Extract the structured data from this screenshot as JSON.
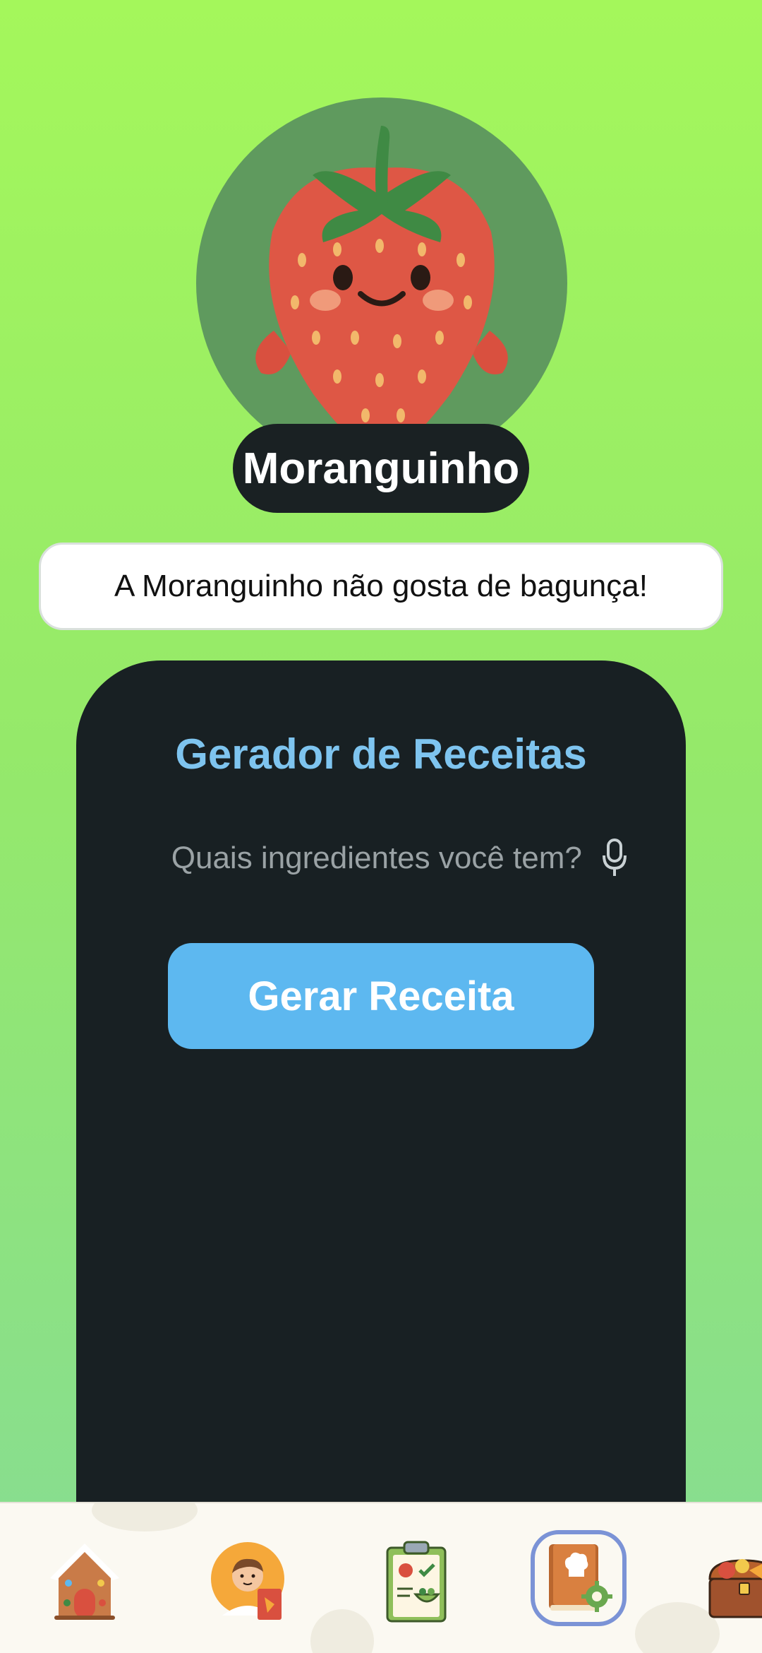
{
  "character": {
    "name": "Moranguinho",
    "message": "A Moranguinho não gosta de bagunça!"
  },
  "recipe_generator": {
    "title": "Gerador de Receitas",
    "ingredients_placeholder": "Quais ingredientes você tem?",
    "generate_button_label": "Gerar Receita"
  },
  "bottom_nav": {
    "items": [
      {
        "icon": "gingerbread-house-icon",
        "active": false
      },
      {
        "icon": "boy-chef-icon",
        "active": false
      },
      {
        "icon": "clipboard-checklist-icon",
        "active": false
      },
      {
        "icon": "cookbook-settings-icon",
        "active": true
      },
      {
        "icon": "food-chest-icon",
        "active": false
      }
    ]
  },
  "colors": {
    "background_top": "#a4f75b",
    "background_bottom": "#86dc95",
    "panel": "#182023",
    "accent_blue": "#5db8f0",
    "title_blue": "#7ec4ef",
    "active_outline": "#7b93d6"
  }
}
